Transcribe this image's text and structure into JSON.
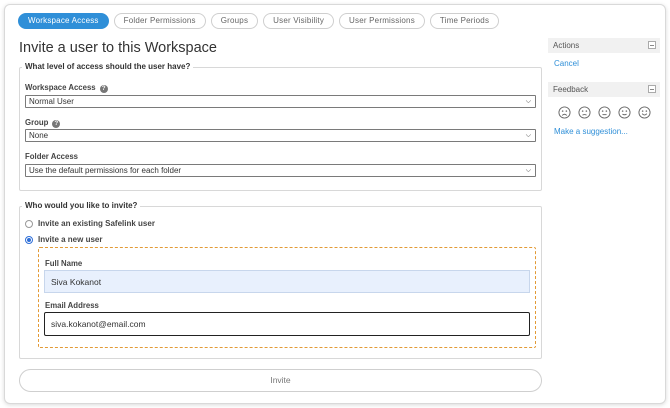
{
  "tabs": [
    {
      "label": "Workspace Access",
      "active": true
    },
    {
      "label": "Folder Permissions",
      "active": false
    },
    {
      "label": "Groups",
      "active": false
    },
    {
      "label": "User Visibility",
      "active": false
    },
    {
      "label": "User Permissions",
      "active": false
    },
    {
      "label": "Time Periods",
      "active": false
    }
  ],
  "page_title": "Invite a user to this Workspace",
  "access_section": {
    "legend": "What level of access should the user have?",
    "workspace_access": {
      "label": "Workspace Access",
      "value": "Normal User"
    },
    "group": {
      "label": "Group",
      "value": "None"
    },
    "folder_access": {
      "label": "Folder Access",
      "value": "Use the default permissions for each folder"
    }
  },
  "invite_section": {
    "legend": "Who would you like to invite?",
    "options": [
      {
        "label": "Invite an existing Safelink user",
        "checked": false
      },
      {
        "label": "Invite a new user",
        "checked": true
      }
    ],
    "full_name": {
      "label": "Full Name",
      "value": "Siva Kokanot"
    },
    "email": {
      "label": "Email Address",
      "value": "siva.kokanot@email.com"
    }
  },
  "invite_button": "Invite",
  "actions_panel": {
    "title": "Actions",
    "cancel": "Cancel"
  },
  "feedback_panel": {
    "title": "Feedback",
    "faces": [
      "very-unhappy-face-icon",
      "unhappy-face-icon",
      "neutral-face-icon",
      "happy-face-icon",
      "very-happy-face-icon"
    ],
    "suggestion": "Make a suggestion..."
  },
  "colors": {
    "accent": "#2f8fd8",
    "highlight_border": "#e39a35",
    "name_field_bg": "#e8f0fd"
  }
}
